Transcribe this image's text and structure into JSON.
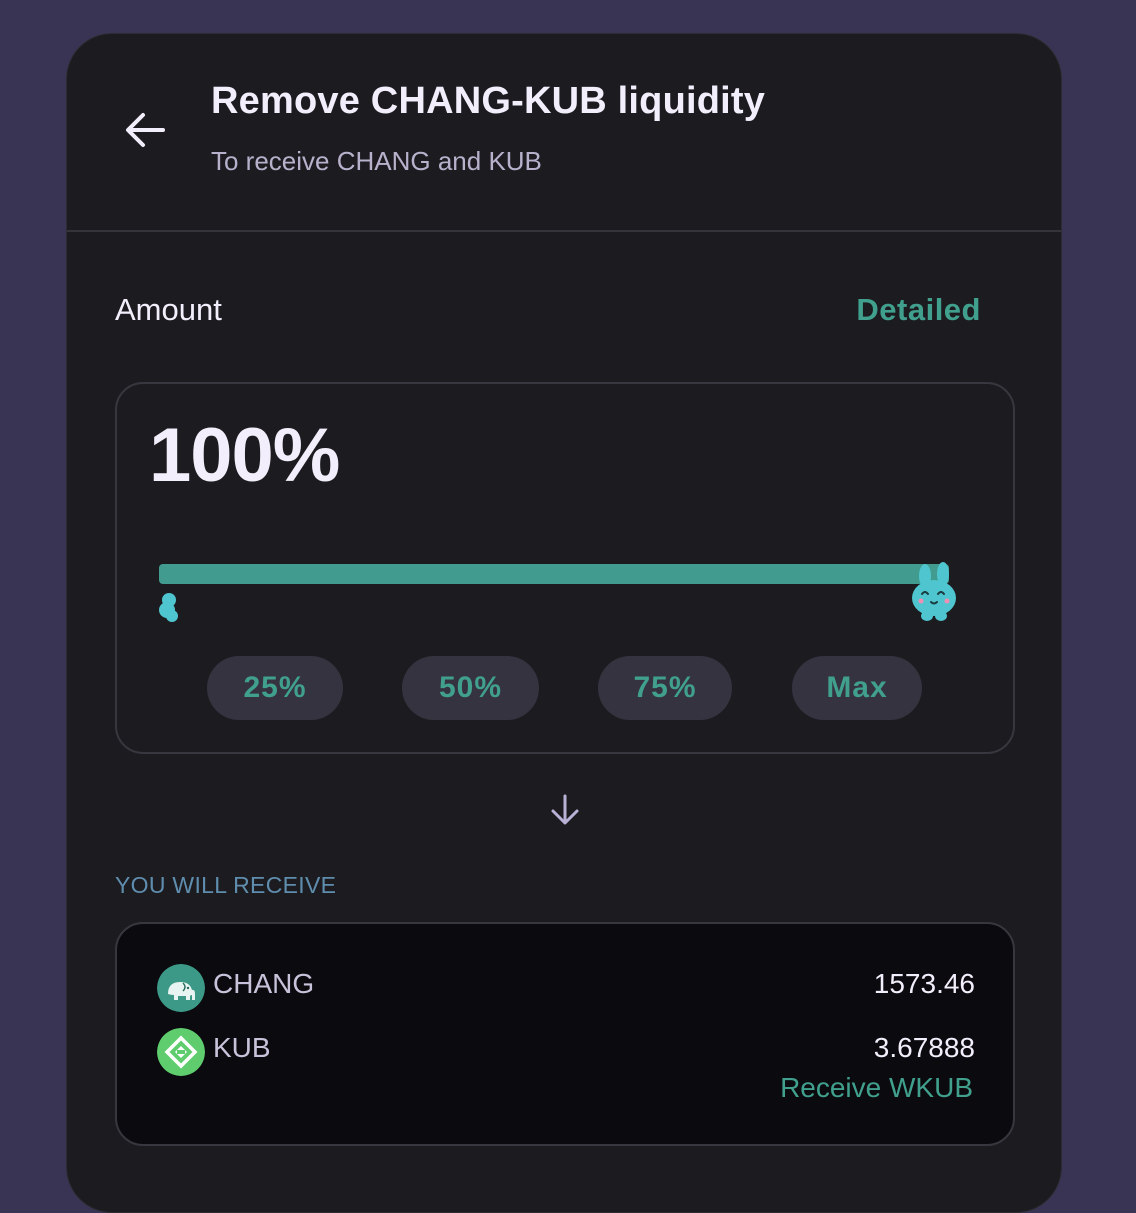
{
  "header": {
    "title": "Remove CHANG-KUB liquidity",
    "subtitle": "To receive CHANG and KUB"
  },
  "amount": {
    "label": "Amount",
    "detailed_link": "Detailed",
    "percent_text": "100%",
    "slider_value_percent": 100,
    "presets": [
      "25%",
      "50%",
      "75%",
      "Max"
    ]
  },
  "receive": {
    "label": "YOU WILL RECEIVE",
    "tokens": [
      {
        "symbol": "CHANG",
        "amount": "1573.46",
        "icon": "elephant-icon"
      },
      {
        "symbol": "KUB",
        "amount": "3.67888",
        "icon": "kub-logo-icon"
      }
    ],
    "wrap_link": "Receive WKUB"
  },
  "colors": {
    "page_background": "#3a3454",
    "card_background": "#1c1c20",
    "accent": "#40a08d",
    "receive_label": "#5f8dae",
    "mascot": "#4fc6cf"
  }
}
